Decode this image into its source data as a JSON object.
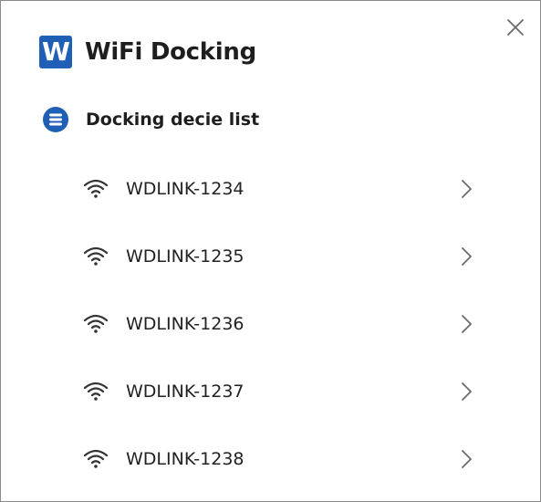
{
  "app": {
    "logo_letter": "W",
    "title": "WiFi Docking"
  },
  "section": {
    "icon": "list-circle-icon",
    "title": "Docking decie list"
  },
  "devices": [
    {
      "name": "WDLINK-1234",
      "icon": "wifi-icon"
    },
    {
      "name": "WDLINK-1235",
      "icon": "wifi-icon"
    },
    {
      "name": "WDLINK-1236",
      "icon": "wifi-icon"
    },
    {
      "name": "WDLINK-1237",
      "icon": "wifi-icon"
    },
    {
      "name": "WDLINK-1238",
      "icon": "wifi-icon"
    }
  ],
  "colors": {
    "brand": "#1f5fb5",
    "text": "#222222",
    "icon": "#4a4a4a"
  }
}
